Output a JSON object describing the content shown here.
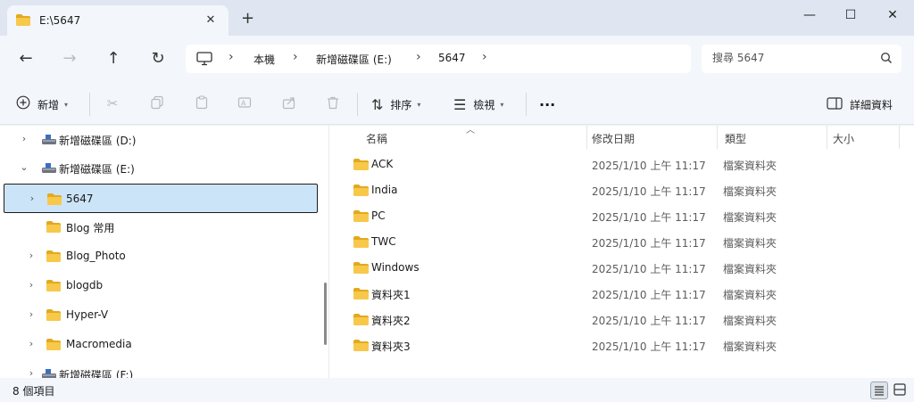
{
  "window": {
    "tab_title": "E:\\5647",
    "new_tab": "+",
    "close_tab": "✕",
    "minimize": "—",
    "maximize": "☐",
    "close": "✕"
  },
  "nav": {
    "back": "←",
    "forward": "→",
    "up": "↑",
    "refresh": "↻",
    "breadcrumb": [
      "本機",
      "新增磁碟區 (E:)",
      "5647"
    ],
    "search_placeholder": "搜尋 5647"
  },
  "commandbar": {
    "new_label": "新增",
    "sort_label": "排序",
    "view_label": "檢視",
    "more": "···",
    "details_label": "詳細資料"
  },
  "navpane": {
    "items": [
      {
        "label": "新增磁碟區 (D:)",
        "type": "drive",
        "chevron": "›"
      },
      {
        "label": "新增磁碟區 (E:)",
        "type": "drive",
        "chevron": "⌄"
      },
      {
        "label": "5647",
        "type": "folder",
        "chevron": "›",
        "selected": true
      },
      {
        "label": "Blog 常用",
        "type": "folder",
        "chevron": ""
      },
      {
        "label": "Blog_Photo",
        "type": "folder",
        "chevron": "›"
      },
      {
        "label": "blogdb",
        "type": "folder",
        "chevron": "›"
      },
      {
        "label": "Hyper-V",
        "type": "folder",
        "chevron": "›"
      },
      {
        "label": "Macromedia",
        "type": "folder",
        "chevron": "›"
      },
      {
        "label": "新增磁碟區 (F:)",
        "type": "drive",
        "chevron": "›"
      }
    ]
  },
  "filelist": {
    "columns": {
      "name": "名稱",
      "modified": "修改日期",
      "type": "類型",
      "size": "大小"
    },
    "rows": [
      {
        "name": "ACK",
        "modified": "2025/1/10 上午 11:17",
        "type": "檔案資料夾"
      },
      {
        "name": "India",
        "modified": "2025/1/10 上午 11:17",
        "type": "檔案資料夾"
      },
      {
        "name": "PC",
        "modified": "2025/1/10 上午 11:17",
        "type": "檔案資料夾"
      },
      {
        "name": "TWC",
        "modified": "2025/1/10 上午 11:17",
        "type": "檔案資料夾"
      },
      {
        "name": "Windows",
        "modified": "2025/1/10 上午 11:17",
        "type": "檔案資料夾"
      },
      {
        "name": "資料夾1",
        "modified": "2025/1/10 上午 11:17",
        "type": "檔案資料夾"
      },
      {
        "name": "資料夾2",
        "modified": "2025/1/10 上午 11:17",
        "type": "檔案資料夾"
      },
      {
        "name": "資料夾3",
        "modified": "2025/1/10 上午 11:17",
        "type": "檔案資料夾"
      }
    ]
  },
  "status": {
    "item_count": "8 個項目"
  },
  "colors": {
    "folder_yellow": "#f7c84a",
    "folder_dark": "#e3a91f",
    "selection": "#cce4f7",
    "chrome": "#f3f6fb"
  }
}
